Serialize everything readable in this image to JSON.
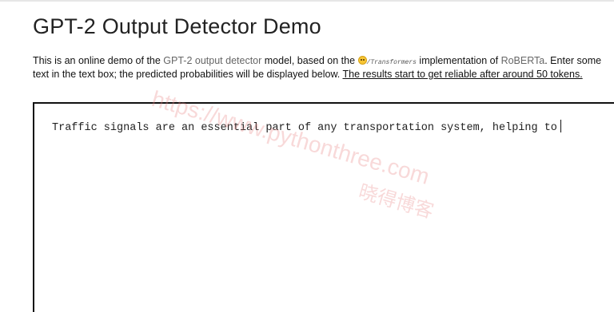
{
  "header": {
    "title": "GPT-2 Output Detector Demo"
  },
  "description": {
    "part1": "This is an online demo of the ",
    "detector_link": "GPT-2 output detector",
    "part2": " model, based on the ",
    "transformers_name": "/Transformers",
    "part3": " implementation of ",
    "roberta_link": "RoBERTa",
    "part4": ". Enter some text in the text box; the predicted probabilities will be displayed below. ",
    "note": "The results start to get reliable after around 50 tokens."
  },
  "textbox": {
    "value": "Traffic signals are an essential part of any transportation system, helping to"
  },
  "watermark": {
    "line1": "https://www.pythonthree.com",
    "line2": "晓得博客"
  },
  "colors": {
    "link": "#666666",
    "watermark": "#e88282"
  }
}
